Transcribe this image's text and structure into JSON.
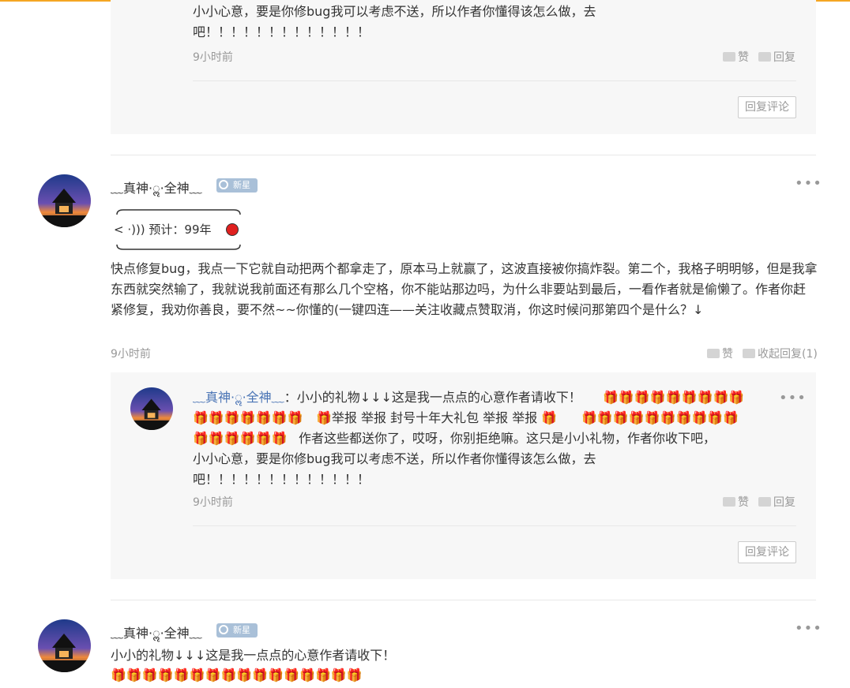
{
  "icons": {
    "like": "thumb-up-icon",
    "reply": "speech-bubble-icon",
    "more": "more-dots-icon",
    "gift": "gift-icon",
    "badge": "star-medal-icon",
    "record": "red-dot-icon"
  },
  "colors": {
    "accent_line": "#f5a623",
    "username_link": "#4a74b5",
    "badge_bg": "#a9c0d8",
    "record_dot": "#e0201f"
  },
  "reply1": {
    "text_line1": "小小心意，要是你修bug我可以考虑不送，所以作者你懂得该怎么做，去",
    "text_line2": "吧！！！！！！！！！！！！！",
    "time": "9小时前",
    "like_label": "赞",
    "reply_label": "回复",
    "reply_comment_button": "回复评论"
  },
  "comment1": {
    "username": "﹏真神·ॢ·全神﹏",
    "badge": "新星",
    "signature_text": "< ·))) 预计：99年",
    "body": "快点修复bug，我点一下它就自动把两个都拿走了，原本马上就赢了，这波直接被你搞炸裂。第二个，我格子明明够，但是我拿东西就突然输了，我就说我前面还有那么几个空格，你不能站那边吗，为什么非要站到最后，一看作者就是偷懒了。作者你赶紧修复，我劝你善良，要不然~~你懂的(一键四连——关注收藏点赞取消，你这时候问那第四个是什么？↓",
    "time": "9小时前",
    "like_label": "赞",
    "collapse_label": "收起回复(1)"
  },
  "reply2": {
    "username": "﹏真神·ॢ·全神﹏",
    "colon": "：",
    "text_a": "小小的礼物↓↓↓这是我一点点的心意作者请收下！",
    "gifts_a": "🎁🎁🎁🎁🎁🎁🎁🎁🎁",
    "gifts_b": "🎁🎁🎁🎁🎁🎁🎁",
    "text_b": "🎁举报 举报 封号十年大礼包 举报 举报 🎁",
    "gifts_c": "🎁🎁🎁🎁🎁🎁🎁🎁🎁🎁",
    "gifts_d": "🎁🎁🎁🎁🎁🎁",
    "text_c": "作者这些都送你了，哎呀，你别拒绝嘛。这只是小小礼物，作者你收下吧，",
    "text_line2": "小小心意，要是你修bug我可以考虑不送，所以作者你懂得该怎么做，去",
    "text_line3": "吧！！！！！！！！！！！！！",
    "time": "9小时前",
    "like_label": "赞",
    "reply_label": "回复",
    "reply_comment_button": "回复评论"
  },
  "comment2": {
    "username": "﹏真神·ॢ·全神﹏",
    "badge": "新星",
    "text": "小小的礼物↓↓↓这是我一点点的心意作者请收下！",
    "gifts": "🎁🎁🎁🎁🎁🎁🎁🎁🎁🎁🎁🎁🎁🎁🎁🎁"
  }
}
